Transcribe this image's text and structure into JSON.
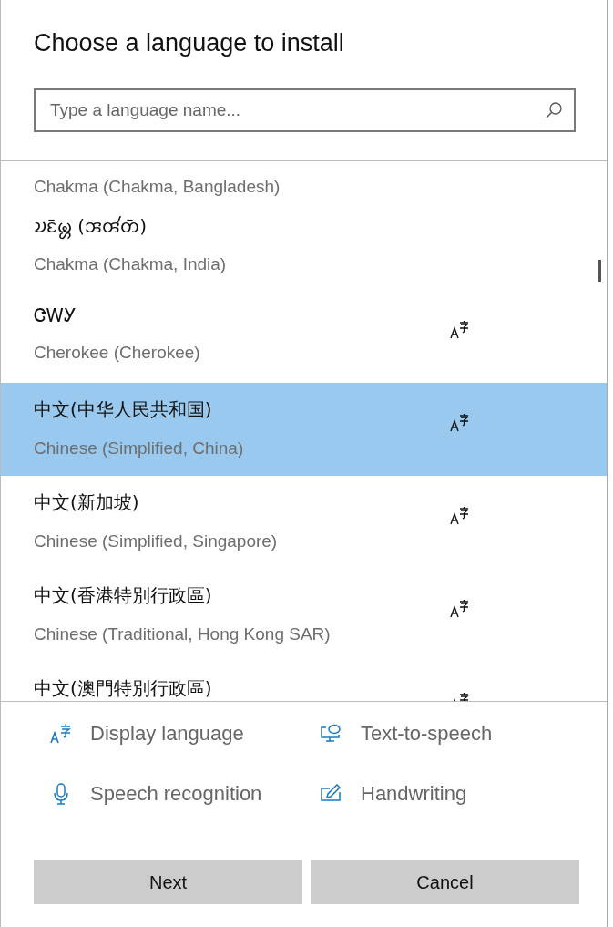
{
  "window": {
    "title": "Choose a language to install"
  },
  "search": {
    "placeholder": "Type a language name..."
  },
  "languages": [
    {
      "subtitle": "Chakma (Chakma, Bangladesh)",
      "display_language": false,
      "selected": false
    },
    {
      "title": "𑄌𑄋𑄴𑄟𑄳𑄦 (𑄞𑄢𑄧𑄖𑄴)",
      "subtitle": "Chakma (Chakma, India)",
      "display_language": false,
      "selected": false
    },
    {
      "title": "ᏣᎳᎩ",
      "subtitle": "Cherokee (Cherokee)",
      "display_language": true,
      "selected": false
    },
    {
      "title": "中文(中华人民共和国)",
      "subtitle": "Chinese (Simplified, China)",
      "display_language": true,
      "selected": true
    },
    {
      "title": "中文(新加坡)",
      "subtitle": "Chinese (Simplified, Singapore)",
      "display_language": true,
      "selected": false
    },
    {
      "title": "中文(香港特別行政區)",
      "subtitle": "Chinese (Traditional, Hong Kong SAR)",
      "display_language": true,
      "selected": false
    },
    {
      "title": "中文(澳門特別行政區)",
      "display_language": true,
      "selected": false
    }
  ],
  "features": [
    {
      "kind": "display",
      "label": "Display language"
    },
    {
      "kind": "tts",
      "label": "Text-to-speech"
    },
    {
      "kind": "speech",
      "label": "Speech recognition"
    },
    {
      "kind": "handwriting",
      "label": "Handwriting"
    }
  ],
  "buttons": [
    {
      "label": "Next"
    },
    {
      "label": "Cancel"
    }
  ]
}
